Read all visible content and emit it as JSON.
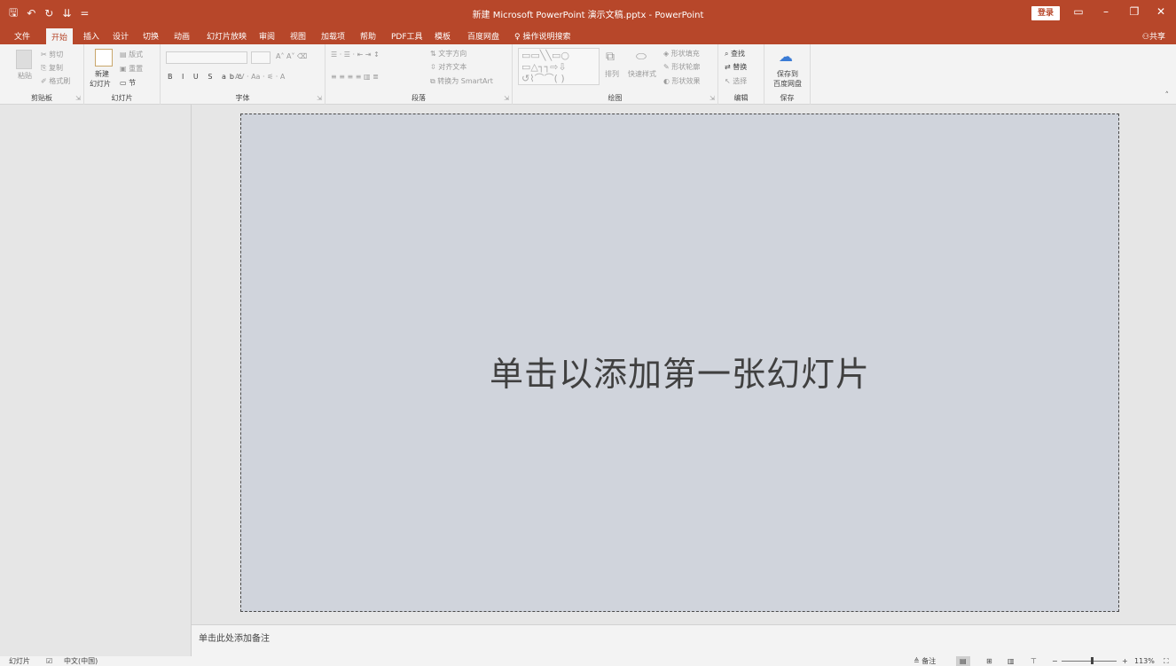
{
  "title_bar": {
    "title": "新建 Microsoft PowerPoint 演示文稿.pptx  -  PowerPoint",
    "login": "登录",
    "qat": [
      "🖫",
      "↶",
      "↻",
      "⇊",
      "="
    ]
  },
  "tabs": [
    "文件",
    "开始",
    "插入",
    "设计",
    "切换",
    "动画",
    "幻灯片放映",
    "审阅",
    "视图",
    "加载项",
    "帮助",
    "PDF工具",
    "模板",
    "百度网盘"
  ],
  "tell_me": "操作说明搜索",
  "share": "共享",
  "ribbon": {
    "clipboard": {
      "label": "剪贴板",
      "paste": "粘贴",
      "cut": "剪切",
      "copy": "复制",
      "format_painter": "格式刷"
    },
    "slides": {
      "label": "幻灯片",
      "new_slide_1": "新建",
      "new_slide_2": "幻灯片",
      "layout": "版式",
      "reset": "重置",
      "section": "节"
    },
    "font": {
      "label": "字体"
    },
    "paragraph": {
      "label": "段落",
      "text_direction": "文字方向",
      "align_text": "对齐文本",
      "smartart": "转换为 SmartArt"
    },
    "drawing": {
      "label": "绘图",
      "arrange": "排列",
      "quick_styles": "快速样式",
      "fill": "形状填充",
      "outline": "形状轮廓",
      "effects": "形状效果"
    },
    "editing": {
      "label": "编辑",
      "find": "查找",
      "replace": "替换",
      "select": "选择"
    },
    "save": {
      "label": "保存",
      "save_to_1": "保存到",
      "save_to_2": "百度网盘"
    }
  },
  "slide": {
    "placeholder": "单击以添加第一张幻灯片"
  },
  "notes": {
    "placeholder": "单击此处添加备注"
  },
  "status": {
    "slide": "幻灯片",
    "language": "中文(中国)",
    "notes_btn": "备注",
    "zoom": "113%",
    "zoom_fraction": 0.55
  },
  "colors": {
    "accent": "#b7472a",
    "slide_bg": "#d0d4dc"
  }
}
